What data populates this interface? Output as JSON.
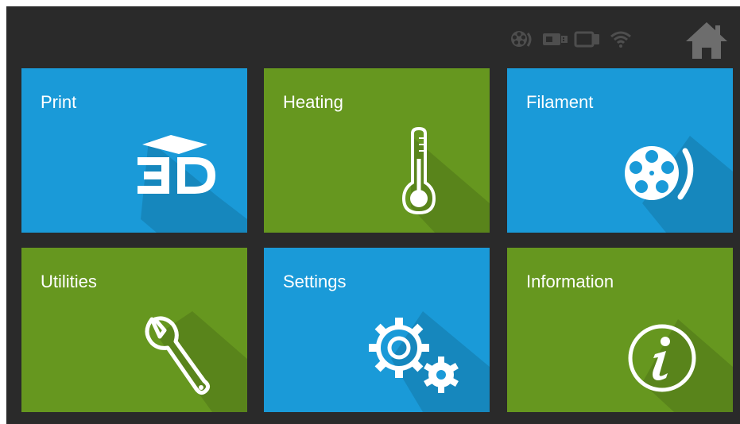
{
  "colors": {
    "blue": "#1a9ad8",
    "green": "#66971f",
    "background": "#2a2a2a",
    "status_icon": "#4e4e4e",
    "home_icon": "#6d6d6d"
  },
  "status_bar": {
    "icons": [
      "filament-reel-icon",
      "usb-stick-icon",
      "tablet-icon",
      "wifi-icon"
    ],
    "home_icon": "home-icon"
  },
  "tiles": [
    {
      "label": "Print",
      "icon": "3d-icon",
      "color": "blue"
    },
    {
      "label": "Heating",
      "icon": "thermometer-icon",
      "color": "green"
    },
    {
      "label": "Filament",
      "icon": "filament-reel-icon",
      "color": "blue"
    },
    {
      "label": "Utilities",
      "icon": "wrench-icon",
      "color": "green"
    },
    {
      "label": "Settings",
      "icon": "gears-icon",
      "color": "blue"
    },
    {
      "label": "Information",
      "icon": "info-icon",
      "color": "green"
    }
  ]
}
